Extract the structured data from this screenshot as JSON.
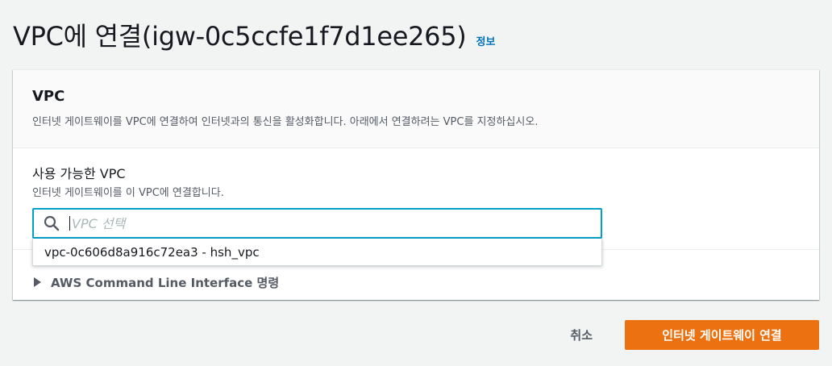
{
  "header": {
    "title": "VPC에 연결(igw-0c5ccfe1f7d1ee265)",
    "info_link": "정보"
  },
  "panel": {
    "title": "VPC",
    "description": "인터넷 게이트웨이를 VPC에 연결하여 인터넷과의 통신을 활성화합니다. 아래에서 연결하려는 VPC를 지정하십시오.",
    "field": {
      "label": "사용 가능한 VPC",
      "description": "인터넷 게이트웨이를 이 VPC에 연결합니다.",
      "search_placeholder": "VPC 선택",
      "search_value": "",
      "search_icon": "search-icon",
      "options": [
        "vpc-0c606d8a916c72ea3 - hsh_vpc"
      ]
    },
    "cli_expander": "AWS Command Line Interface 명령"
  },
  "footer": {
    "cancel_label": "취소",
    "submit_label": "인터넷 게이트웨이 연결"
  },
  "colors": {
    "accent": "#ec7211",
    "focus": "#00a1c9",
    "link": "#0073bb"
  }
}
